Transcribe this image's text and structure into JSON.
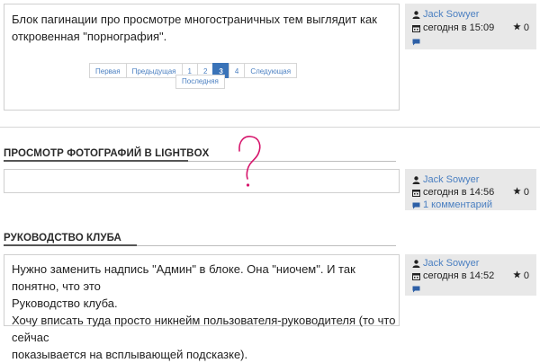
{
  "posts": [
    {
      "text_lines": [
        "Блок пагинации про просмотре многостраничных тем выглядит как",
        "откровенная \"порнография\"."
      ],
      "meta": {
        "author": "Jack Sowyer",
        "time": "сегодня в 15:09",
        "stars": "0",
        "comments": ""
      }
    },
    {
      "meta": {
        "author": "Jack Sowyer",
        "time": "сегодня в 14:56",
        "stars": "0",
        "comments": "1 комментарий"
      }
    },
    {
      "text_lines": [
        "Нужно заменить надпись \"Админ\" в блоке. Она \"ниочем\". И так понятно, что это",
        "Руководство клуба.",
        "Хочу вписать туда просто никнейм пользователя-руководителя (то что сейчас",
        "показывается на всплывающей подсказке)."
      ],
      "meta": {
        "author": "Jack Sowyer",
        "time": "сегодня в 14:52",
        "stars": "0",
        "comments": ""
      }
    }
  ],
  "topics": [
    {
      "title": "ПРОСМОТР ФОТОГРАФИЙ В LIGHTBOX"
    },
    {
      "title": "РУКОВОДСТВО КЛУБА"
    }
  ],
  "pagination": {
    "pages": [
      "Первая",
      "Предыдущая",
      "1",
      "2",
      "3",
      "4",
      "Следующая"
    ],
    "active_page": "3",
    "tooltip": "Последняя"
  },
  "annotation": {
    "mark": "?",
    "color": "#d6156c"
  },
  "colors": {
    "link": "#4a7fc1",
    "meta_bg": "#e8e8e8",
    "active_page": "#3a73b8"
  },
  "icons": [
    "user-icon",
    "calendar-icon",
    "star-icon",
    "comment-icon"
  ]
}
